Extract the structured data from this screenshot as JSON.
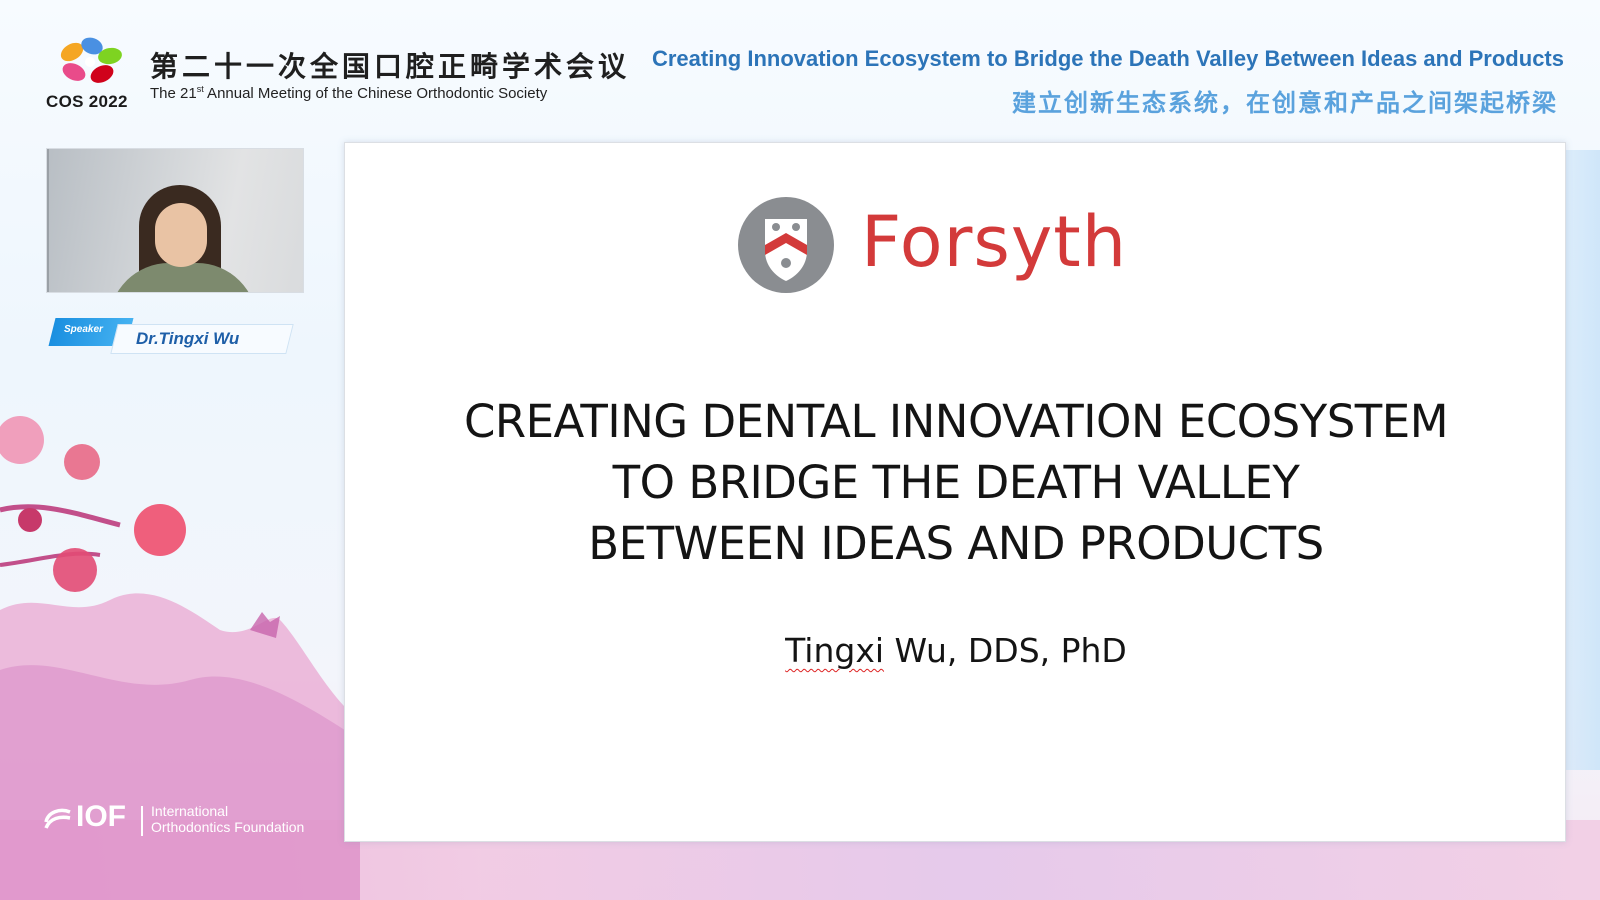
{
  "conference": {
    "logo_year": "COS 2022",
    "title_cn": "第二十一次全国口腔正畸学术会议",
    "title_en_prefix": "The 21",
    "title_en_sup": "st",
    "title_en_suffix": " Annual Meeting of the Chinese Orthodontic Society"
  },
  "topic": {
    "title_en": "Creating Innovation Ecosystem to Bridge the Death Valley Between Ideas and Products",
    "title_cn": "建立创新生态系统，在创意和产品之间架起桥梁"
  },
  "speaker": {
    "tag": "Speaker",
    "name": "Dr.Tingxi Wu"
  },
  "sponsor": {
    "short_name": "IOF",
    "line1": "International",
    "line2": "Orthodontics Foundation"
  },
  "slide": {
    "brand": "Forsyth",
    "title_lines": [
      "CREATING DENTAL INNOVATION ECOSYSTEM",
      "TO BRIDGE THE DEATH VALLEY",
      "BETWEEN IDEAS AND PRODUCTS"
    ],
    "author_first": "Tingxi",
    "author_rest": " Wu, DDS, PhD"
  },
  "colors": {
    "topic_en": "#2c74b8",
    "topic_cn": "#5aa2dd",
    "brand_red": "#d33a3a",
    "speaker_name": "#1e5fa8"
  }
}
